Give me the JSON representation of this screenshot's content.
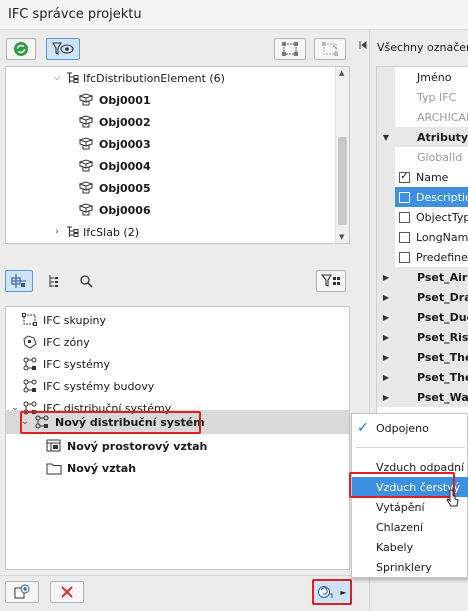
{
  "window": {
    "title": "IFC správce projektu"
  },
  "top_tree": {
    "rows": [
      {
        "label": "IfcDistributionElement (6)",
        "expanded": true,
        "icon": "ifc-class-icon"
      },
      {
        "label": "Obj0001",
        "icon": "object-icon"
      },
      {
        "label": "Obj0002",
        "icon": "object-icon"
      },
      {
        "label": "Obj0003",
        "icon": "object-icon"
      },
      {
        "label": "Obj0004",
        "icon": "object-icon"
      },
      {
        "label": "Obj0005",
        "icon": "object-icon"
      },
      {
        "label": "Obj0006",
        "icon": "object-icon"
      },
      {
        "label": "IfcSlab (2)",
        "expanded": false,
        "icon": "ifc-class-icon"
      }
    ]
  },
  "bottom_tree": {
    "rows": [
      {
        "label": "IFC skupiny",
        "icon": "group-icon"
      },
      {
        "label": "IFC zóny",
        "icon": "zone-icon"
      },
      {
        "label": "IFC systémy",
        "icon": "system-icon"
      },
      {
        "label": "IFC systémy budovy",
        "icon": "system-icon"
      },
      {
        "label": "IFC distribuční systémy",
        "icon": "system-icon",
        "expanded": true
      },
      {
        "label": "Nový distribuční systém",
        "icon": "distribution-system-icon",
        "selected": true
      },
      {
        "label": "Nový prostorový vztah",
        "icon": "spatial-relation-icon"
      },
      {
        "label": "Nový vztah",
        "icon": "folder-icon"
      }
    ]
  },
  "right_panel": {
    "header": "Všechny označené",
    "rows": [
      {
        "label": "Jméno",
        "type": "plain"
      },
      {
        "label": "Typ IFC",
        "type": "muted"
      },
      {
        "label": "ARCHICAD",
        "type": "muted"
      },
      {
        "label": "Atributy",
        "type": "group"
      },
      {
        "label": "GlobalId",
        "type": "muted"
      },
      {
        "label": "Name",
        "type": "check",
        "checked": true
      },
      {
        "label": "Description",
        "type": "check",
        "checked": false,
        "highlight": true
      },
      {
        "label": "ObjectType",
        "type": "check",
        "checked": false
      },
      {
        "label": "LongName",
        "type": "check",
        "checked": false
      },
      {
        "label": "Predefined",
        "type": "check",
        "checked": false
      },
      {
        "label": "Pset_AirSi",
        "type": "group"
      },
      {
        "label": "Pset_Drain",
        "type": "group"
      },
      {
        "label": "Pset_Duct",
        "type": "group"
      },
      {
        "label": "Pset_Risk",
        "type": "group"
      },
      {
        "label": "Pset_Ther",
        "type": "group"
      },
      {
        "label": "Pset_Ther",
        "type": "group"
      },
      {
        "label": "Pset_Warr",
        "type": "group"
      }
    ]
  },
  "context_menu": {
    "items": [
      {
        "label": "Odpojeno",
        "checked": true
      },
      {
        "label": "Vzduch odpadní"
      },
      {
        "label": "Vzduch čerstvý",
        "highlight": true
      },
      {
        "label": "Vytápění"
      },
      {
        "label": "Chlazení"
      },
      {
        "label": "Kabely"
      },
      {
        "label": "Sprinklery"
      }
    ]
  },
  "colors": {
    "accent": "#3d8fdf",
    "highlight_box": "#e02020",
    "green_icon": "#2f9e41",
    "delete_red": "#e03030"
  }
}
